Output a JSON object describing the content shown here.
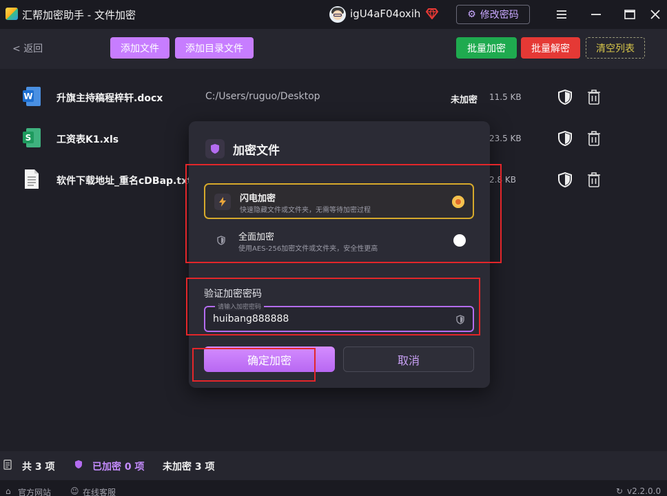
{
  "window": {
    "title": "汇帮加密助手 - 文件加密",
    "username": "igU4aF04oxih",
    "change_password": "修改密码"
  },
  "toolbar": {
    "back": "返回",
    "add_file": "添加文件",
    "add_folder": "添加目录文件",
    "batch_encrypt": "批量加密",
    "batch_decrypt": "批量解密",
    "clear_list": "清空列表"
  },
  "files": [
    {
      "name": "升旗主持稿程梓轩.docx",
      "path": "C:/Users/ruguo/Desktop",
      "status": "未加密",
      "size": "11.5 KB",
      "icon": "word-file-icon"
    },
    {
      "name": "工资表K1.xls",
      "path": "",
      "status": "",
      "size": "23.5 KB",
      "icon": "excel-file-icon"
    },
    {
      "name": "软件下载地址_重名cDBap.txt",
      "path": "",
      "status": "",
      "size": "2.8 KB",
      "icon": "text-file-icon"
    }
  ],
  "footer": {
    "total": "共 3 项",
    "encrypted": "已加密 0 项",
    "unencrypted": "未加密 3 项"
  },
  "statusbar": {
    "website": "官方网站",
    "support": "在线客服",
    "version": "v2.2.0.0"
  },
  "modal": {
    "title": "加密文件",
    "options": [
      {
        "title": "闪电加密",
        "desc": "快速隐藏文件或文件夹，无需等待加密过程",
        "selected": true
      },
      {
        "title": "全面加密",
        "desc": "使用AES-256加密文件或文件夹，安全性更高",
        "selected": false
      }
    ],
    "password_label": "验证加密密码",
    "password_placeholder": "请输入加密密码",
    "password_value": "huibang888888",
    "confirm": "确定加密",
    "cancel": "取消"
  },
  "colors": {
    "accent_purple": "#c77dff",
    "encrypt_green": "#1faa4f",
    "decrypt_red": "#e53935",
    "clear_yellow": "#d8c64a",
    "annotation_red": "#e3262a"
  }
}
